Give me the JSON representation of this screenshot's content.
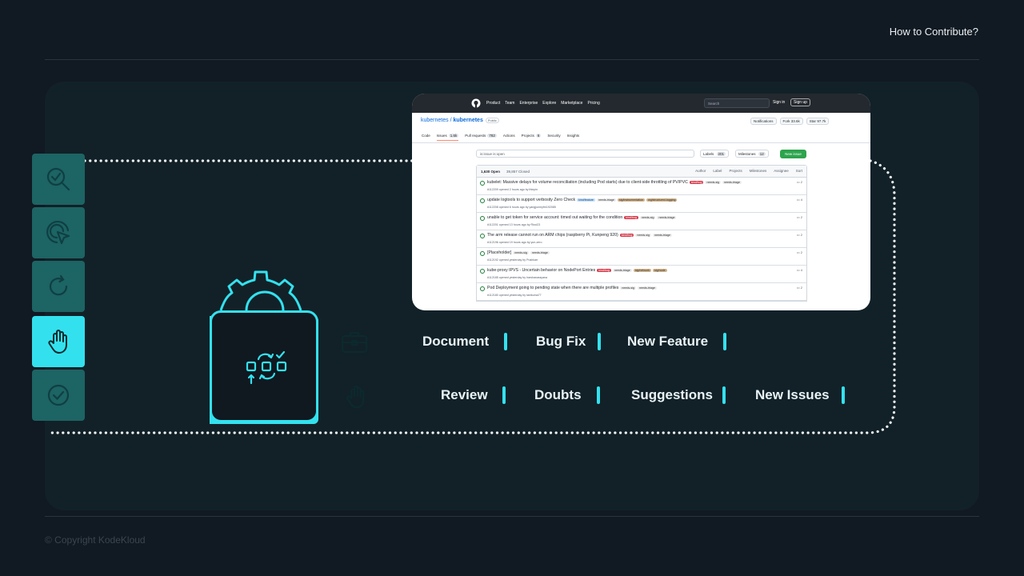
{
  "header": {
    "title": "How to Contribute?"
  },
  "footer": {
    "copyright": "© Copyright KodeKloud"
  },
  "rail": {
    "items": [
      {
        "icon": "search-check-icon",
        "active": false
      },
      {
        "icon": "target-pointer-icon",
        "active": false
      },
      {
        "icon": "refresh-icon",
        "active": false
      },
      {
        "icon": "hand-icon",
        "active": true
      },
      {
        "icon": "check-circle-icon",
        "active": false
      }
    ]
  },
  "screenshot": {
    "nav": [
      "Product",
      "Team",
      "Enterprise",
      "Explore",
      "Marketplace",
      "Pricing"
    ],
    "search": "Search",
    "sign_in": "Sign in",
    "sign_up": "Sign up",
    "repo_owner": "kubernetes",
    "repo_name": "kubernetes",
    "repo_visibility": "Public",
    "notifications": "Notifications",
    "fork": "Fork",
    "fork_count": "33.6k",
    "star": "Star",
    "star_count": "97.7k",
    "tabs": [
      {
        "label": "Code",
        "count": ""
      },
      {
        "label": "Issues",
        "count": "1.6k"
      },
      {
        "label": "Pull requests",
        "count": "782"
      },
      {
        "label": "Actions",
        "count": ""
      },
      {
        "label": "Projects",
        "count": "6"
      },
      {
        "label": "Security",
        "count": ""
      },
      {
        "label": "Insights",
        "count": ""
      }
    ],
    "filter": "is:issue is:open",
    "labels_btn": "Labels",
    "labels_count": "201",
    "milestones_btn": "Milestones",
    "milestones_count": "12",
    "new_issue": "New issue",
    "open_count": "1,630 Open",
    "closed_count": "39,857 Closed",
    "sorts": [
      "Author",
      "Label",
      "Projects",
      "Milestones",
      "Assignee",
      "Sort"
    ],
    "issues": [
      {
        "title": "kubelet: Massive delays for volume reconciliation (including Pod starts) due to client-side throttling of PV/PVC",
        "meta": "#112209 opened 2 hours ago by thinpin",
        "labels": [
          "kind/bug",
          "needs-sig",
          "needs-triage"
        ],
        "comments": "2"
      },
      {
        "title": "update logtools to support verbosity Zero Check",
        "meta": "#112208 opened 6 hours ago by yangjunmyfm192085",
        "labels": [
          "kind/feature",
          "needs-triage",
          "sig/instrumentation",
          "wg/structured-logging"
        ],
        "comments": "4"
      },
      {
        "title": "unable to get token for service account: timed out waiting for the condition",
        "meta": "#112201 opened 13 hours ago by Ricci23",
        "labels": [
          "kind/bug",
          "needs-sig",
          "needs-triage"
        ],
        "comments": "2"
      },
      {
        "title": "The arm release cannot run on ARM chips (raspberry Pi, Kunpeng 920)",
        "meta": "#112196 opened 19 hours ago by yun-zero",
        "labels": [
          "kind/bug",
          "needs-sig",
          "needs-triage"
        ],
        "comments": "2"
      },
      {
        "title": "[Placeholder]",
        "meta": "#112192 opened yesterday by Pushkarr",
        "labels": [
          "needs-sig",
          "needs-triage"
        ],
        "comments": "2"
      },
      {
        "title": "kube-proxy IPVS - Uncertain behavior on NodePort Entries",
        "meta": "#112185 opened yesterday by harshanarayana",
        "labels": [
          "kind/bug",
          "needs-triage",
          "sig/network",
          "sig/node"
        ],
        "comments": "4"
      },
      {
        "title": "Pod Deployment going to pending state when there are multiple profiles",
        "meta": "#112180 opened yesterday by tanikuma77",
        "labels": [
          "needs-sig",
          "needs-triage"
        ],
        "comments": "2"
      }
    ]
  },
  "contribution_types": {
    "row1": [
      "Document",
      "Bug Fix",
      "New Feature"
    ],
    "row2": [
      "Review",
      "Doubts",
      "Suggestions",
      "New Issues"
    ]
  },
  "colors": {
    "accent": "#33e1ee",
    "rail": "#1d6464",
    "background": "#111922",
    "panel": "#122128"
  }
}
